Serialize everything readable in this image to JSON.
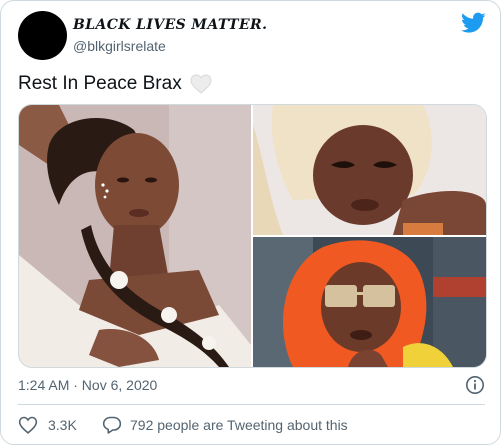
{
  "author": {
    "display_name": "BLACK LIVES MATTER.",
    "handle": "@blkgirlsrelate"
  },
  "tweet": {
    "text": "Rest In Peace Brax",
    "emoji": "white-heart-icon"
  },
  "media": {
    "photos": [
      {
        "name": "portrait-braided-hair"
      },
      {
        "name": "portrait-platinum-wig"
      },
      {
        "name": "portrait-orange-hair-glasses"
      }
    ]
  },
  "meta": {
    "timestamp": "1:24 AM · Nov 6, 2020"
  },
  "actions": {
    "like_count": "3.3K",
    "reply_text": "792 people are Tweeting about this"
  },
  "colors": {
    "twitter_blue": "#1d9bf0",
    "secondary_text": "#536471",
    "border": "#cfd9de"
  }
}
